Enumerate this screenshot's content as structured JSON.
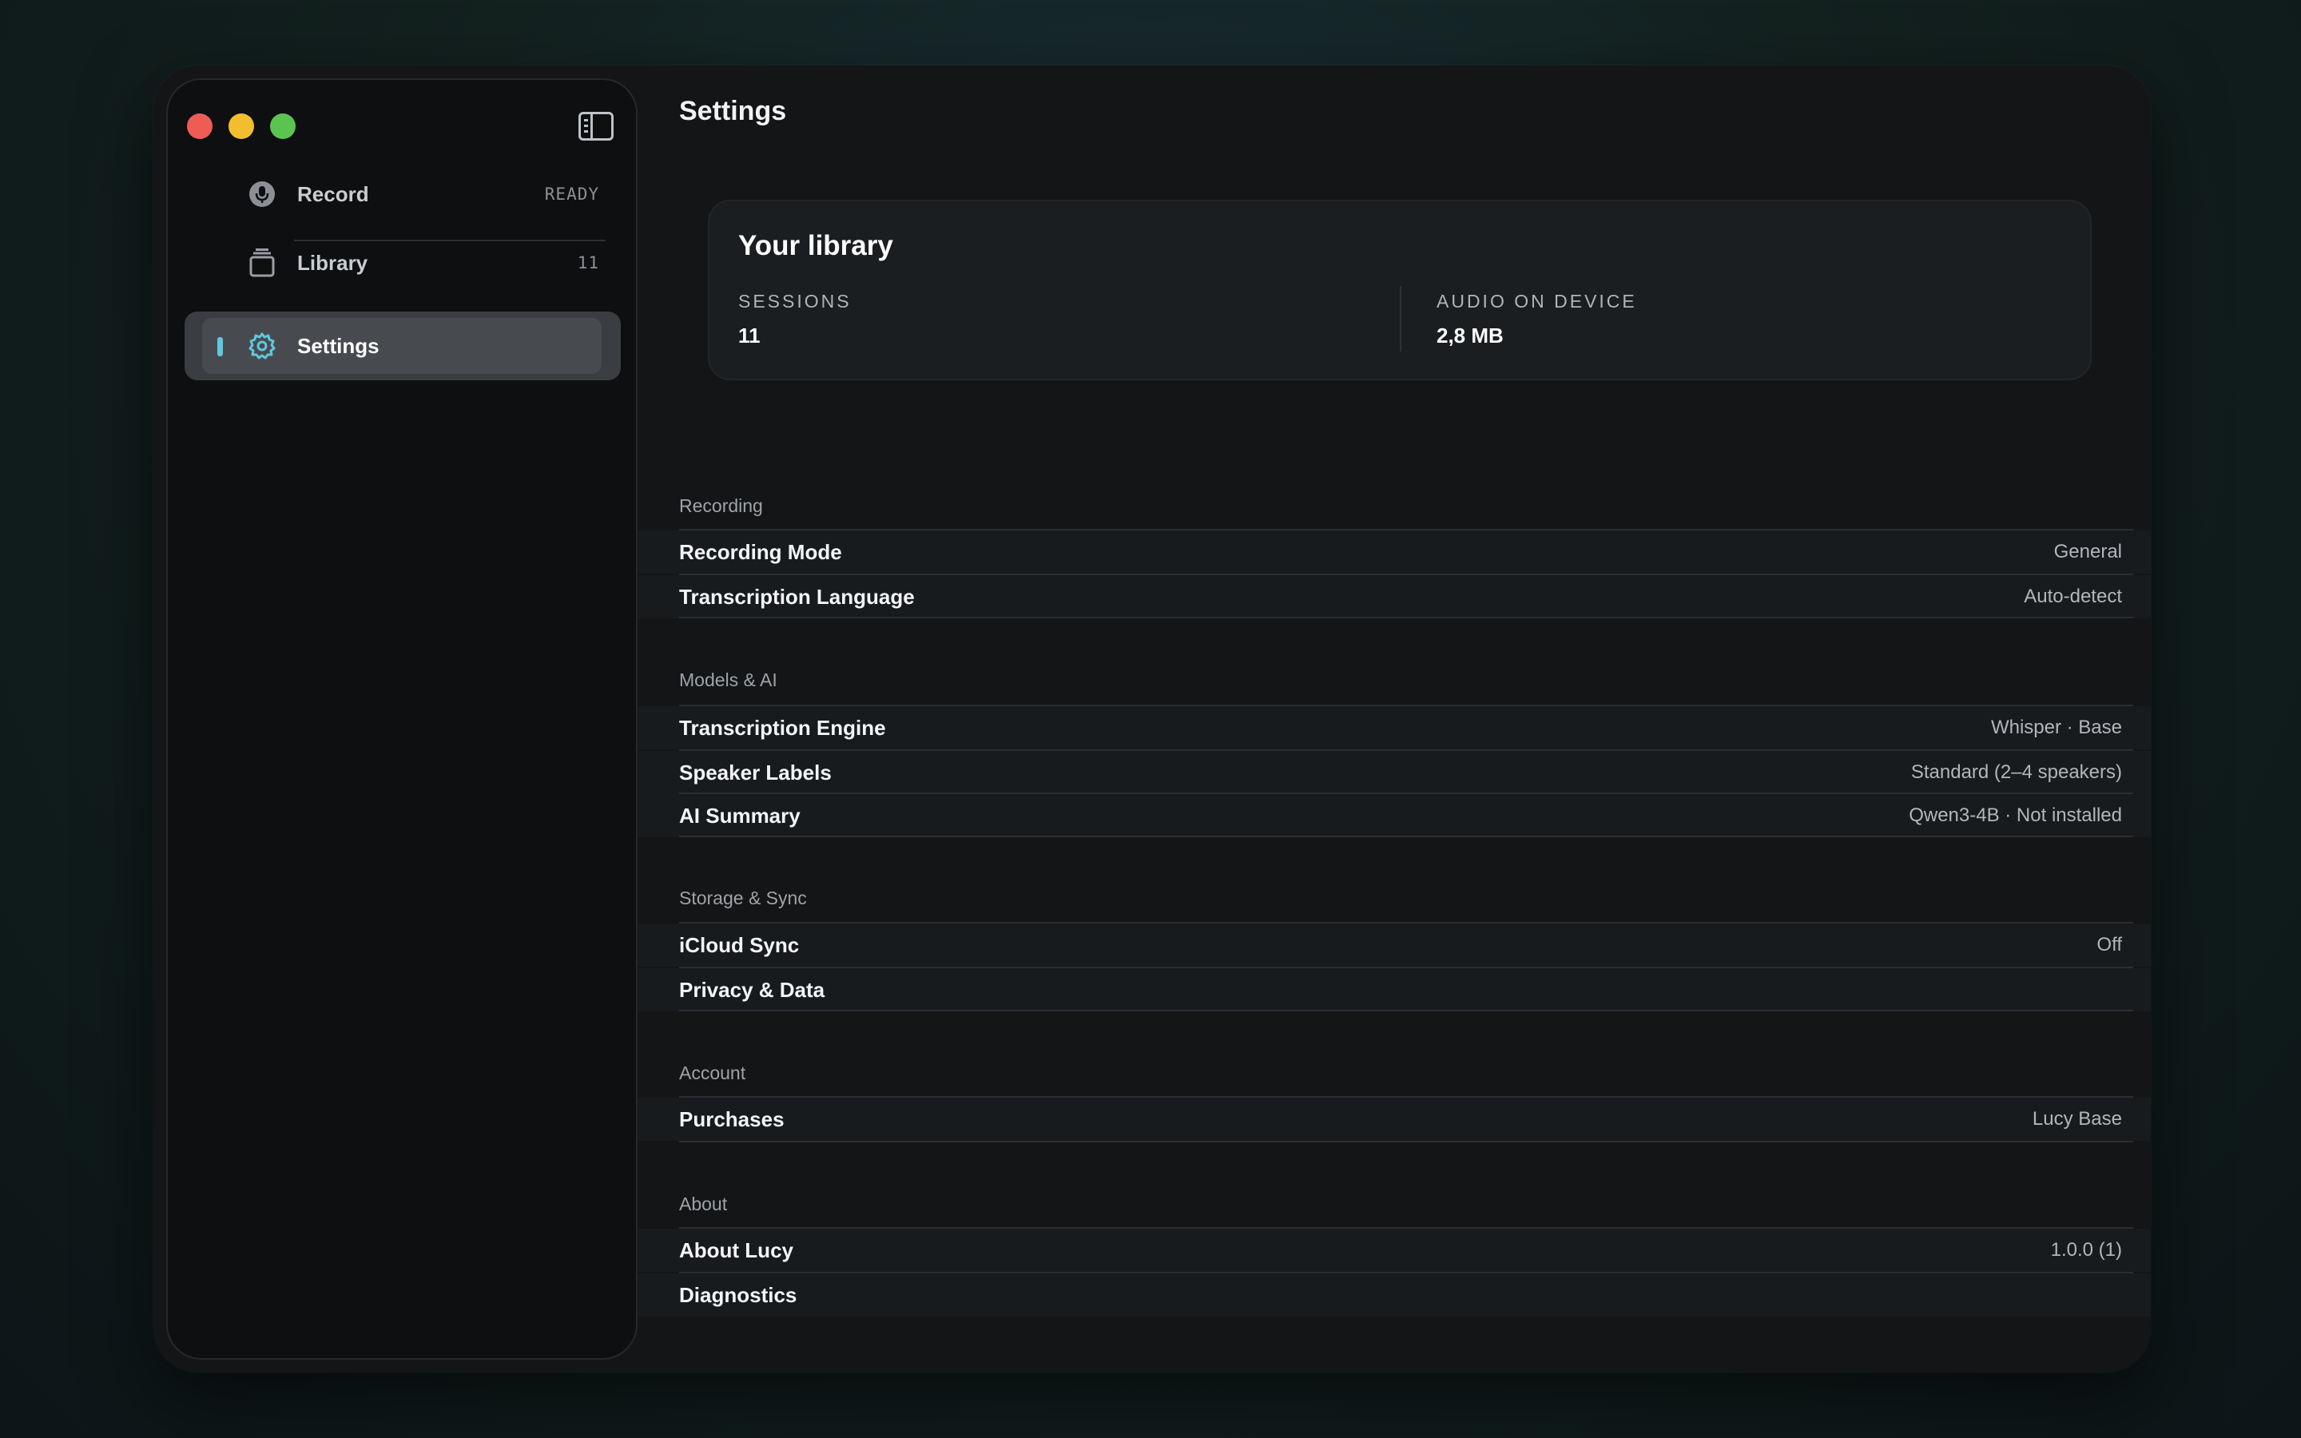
{
  "window": {
    "title": "Settings"
  },
  "sidebar": {
    "items": [
      {
        "label": "Record",
        "meta": "READY",
        "icon": "microphone-icon"
      },
      {
        "label": "Library",
        "meta": "11",
        "icon": "stack-icon"
      },
      {
        "label": "Settings",
        "meta": "",
        "icon": "gear-icon",
        "selected": true
      }
    ],
    "accent": "#5fc8de"
  },
  "library": {
    "title": "Your library",
    "sessions_label": "SESSIONS",
    "sessions_value": "11",
    "audio_label": "AUDIO ON DEVICE",
    "audio_value": "2,8 MB"
  },
  "sections": {
    "recording": {
      "label": "Recording",
      "rows": [
        {
          "label": "Recording Mode",
          "value": "General"
        },
        {
          "label": "Transcription Language",
          "value": "Auto-detect"
        }
      ]
    },
    "models": {
      "label": "Models & AI",
      "rows": [
        {
          "label": "Transcription Engine",
          "value": "Whisper · Base"
        },
        {
          "label": "Speaker Labels",
          "value": "Standard (2–4 speakers)"
        },
        {
          "label": "AI Summary",
          "value": "Qwen3-4B · Not installed"
        }
      ]
    },
    "storage": {
      "label": "Storage & Sync",
      "rows": [
        {
          "label": "iCloud Sync",
          "value": "Off"
        },
        {
          "label": "Privacy & Data",
          "value": ""
        }
      ]
    },
    "account": {
      "label": "Account",
      "rows": [
        {
          "label": "Purchases",
          "value": "Lucy Base"
        }
      ]
    },
    "about": {
      "label": "About",
      "rows": [
        {
          "label": "About Lucy",
          "value": "1.0.0 (1)"
        },
        {
          "label": "Diagnostics",
          "value": ""
        }
      ]
    }
  }
}
